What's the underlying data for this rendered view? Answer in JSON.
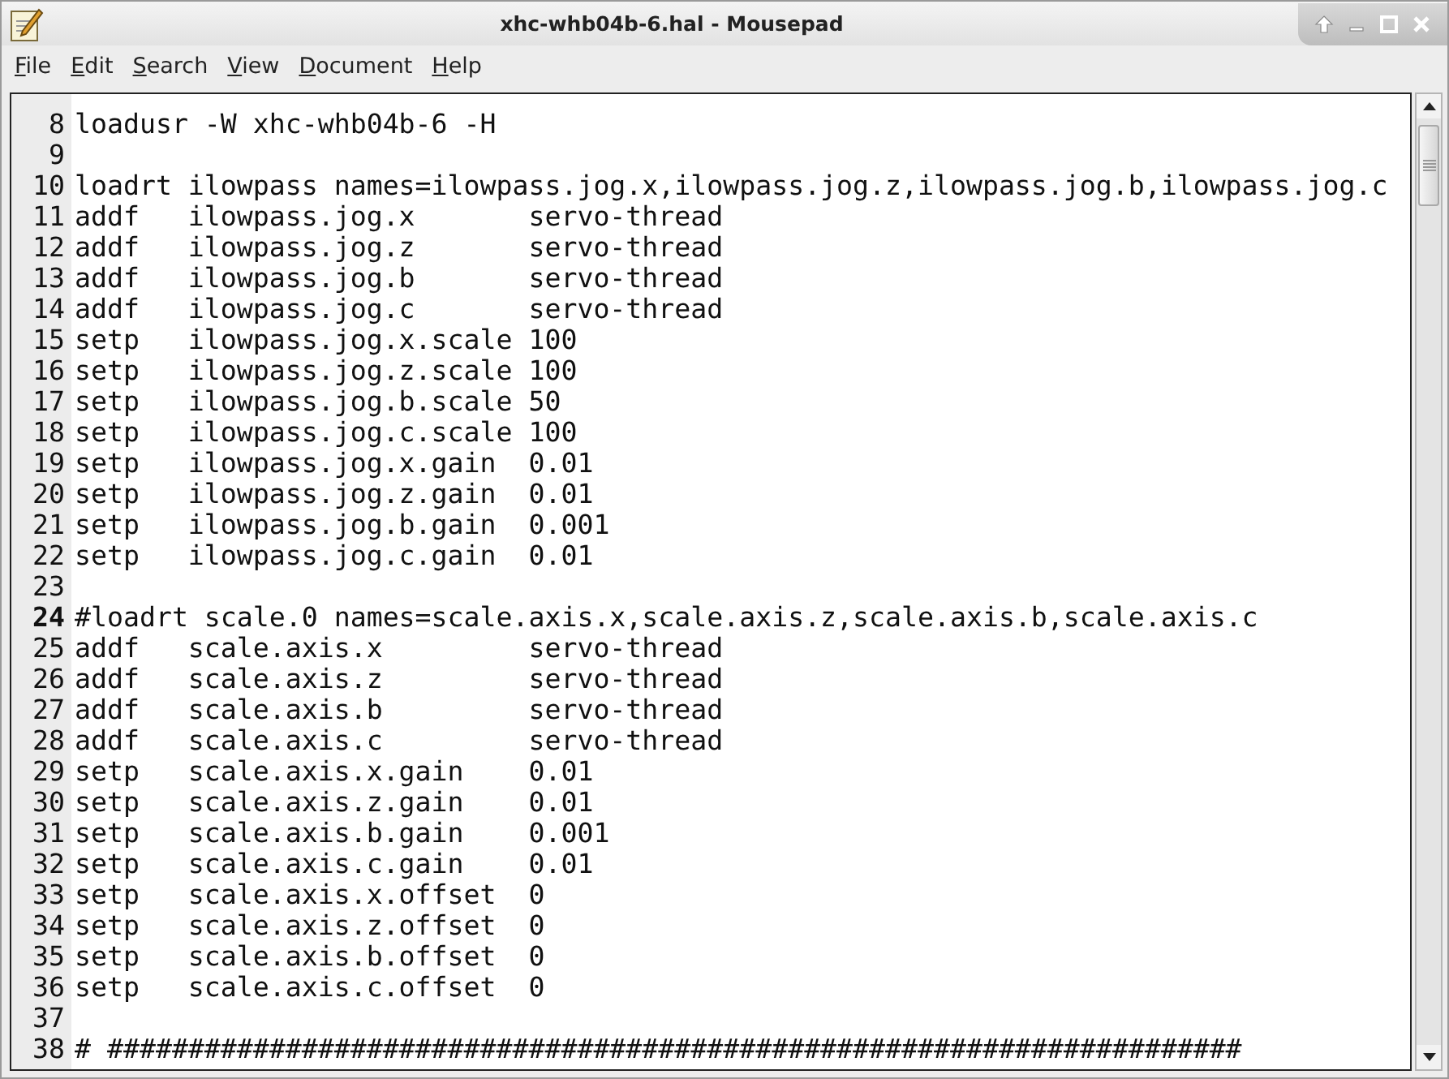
{
  "window": {
    "title": "xhc-whb04b-6.hal - Mousepad"
  },
  "menu": [
    {
      "label": "File"
    },
    {
      "label": "Edit"
    },
    {
      "label": "Search"
    },
    {
      "label": "View"
    },
    {
      "label": "Document"
    },
    {
      "label": "Help"
    }
  ],
  "editor": {
    "lines": [
      {
        "number": "8",
        "text": "loadusr -W xhc-whb04b-6 -H",
        "current": false
      },
      {
        "number": "9",
        "current": false
      },
      {
        "number": "10",
        "text": "loadrt ilowpass names=ilowpass.jog.x,ilowpass.jog.z,ilowpass.jog.b,ilowpass.jog.c",
        "current": false
      },
      {
        "number": "11",
        "text": "addf   ilowpass.jog.x       servo-thread",
        "current": false
      },
      {
        "number": "12",
        "text": "addf   ilowpass.jog.z       servo-thread",
        "current": false
      },
      {
        "number": "13",
        "text": "addf   ilowpass.jog.b       servo-thread",
        "current": false
      },
      {
        "number": "14",
        "text": "addf   ilowpass.jog.c       servo-thread",
        "current": false
      },
      {
        "number": "15",
        "text": "setp   ilowpass.jog.x.scale 100",
        "current": false
      },
      {
        "number": "16",
        "text": "setp   ilowpass.jog.z.scale 100",
        "current": false
      },
      {
        "number": "17",
        "text": "setp   ilowpass.jog.b.scale 50",
        "current": false
      },
      {
        "number": "18",
        "text": "setp   ilowpass.jog.c.scale 100",
        "current": false
      },
      {
        "number": "19",
        "text": "setp   ilowpass.jog.x.gain  0.01",
        "current": false
      },
      {
        "number": "20",
        "text": "setp   ilowpass.jog.z.gain  0.01",
        "current": false
      },
      {
        "number": "21",
        "text": "setp   ilowpass.jog.b.gain  0.001",
        "current": false
      },
      {
        "number": "22",
        "text": "setp   ilowpass.jog.c.gain  0.01",
        "current": false
      },
      {
        "number": "23",
        "current": false
      },
      {
        "number": "24",
        "text": "#loadrt scale.0 names=scale.axis.x,scale.axis.z,scale.axis.b,scale.axis.c",
        "current": true
      },
      {
        "number": "25",
        "text": "addf   scale.axis.x         servo-thread",
        "current": false
      },
      {
        "number": "26",
        "text": "addf   scale.axis.z         servo-thread",
        "current": false
      },
      {
        "number": "27",
        "text": "addf   scale.axis.b         servo-thread",
        "current": false
      },
      {
        "number": "28",
        "text": "addf   scale.axis.c         servo-thread",
        "current": false
      },
      {
        "number": "29",
        "text": "setp   scale.axis.x.gain    0.01",
        "current": false
      },
      {
        "number": "30",
        "text": "setp   scale.axis.z.gain    0.01",
        "current": false
      },
      {
        "number": "31",
        "text": "setp   scale.axis.b.gain    0.001",
        "current": false
      },
      {
        "number": "32",
        "text": "setp   scale.axis.c.gain    0.01",
        "current": false
      },
      {
        "number": "33",
        "text": "setp   scale.axis.x.offset  0",
        "current": false
      },
      {
        "number": "34",
        "text": "setp   scale.axis.z.offset  0",
        "current": false
      },
      {
        "number": "35",
        "text": "setp   scale.axis.b.offset  0",
        "current": false
      },
      {
        "number": "36",
        "text": "setp   scale.axis.c.offset  0",
        "current": false
      },
      {
        "number": "37",
        "current": false
      },
      {
        "number": "38",
        "text": "# ######################################################################",
        "current": false
      }
    ]
  }
}
